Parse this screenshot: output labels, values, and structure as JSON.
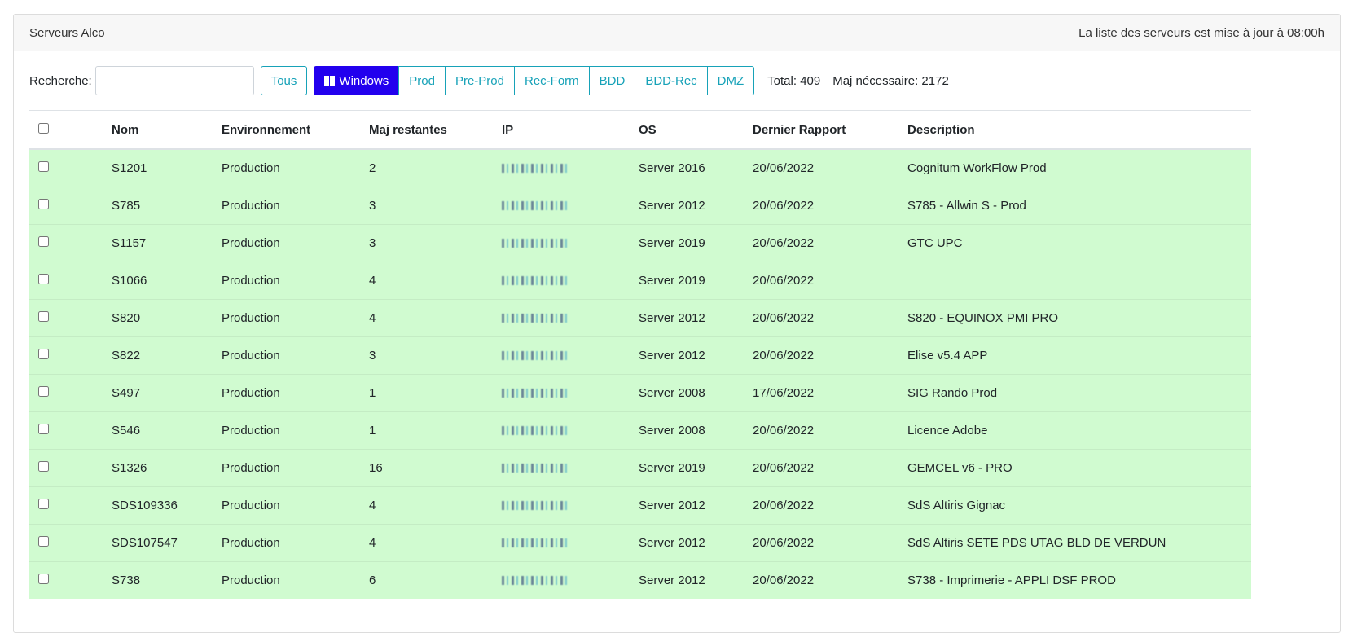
{
  "header": {
    "title": "Serveurs Alco",
    "update_notice": "La liste des serveurs est mise à jour à 08:00h"
  },
  "toolbar": {
    "search_label": "Recherche:",
    "search_value": "",
    "all_label": "Tous",
    "filters": [
      {
        "label": "Windows",
        "active": true
      },
      {
        "label": "Prod",
        "active": false
      },
      {
        "label": "Pre-Prod",
        "active": false
      },
      {
        "label": "Rec-Form",
        "active": false
      },
      {
        "label": "BDD",
        "active": false
      },
      {
        "label": "BDD-Rec",
        "active": false
      },
      {
        "label": "DMZ",
        "active": false
      }
    ],
    "total": "Total: 409",
    "maj_needed": "Maj nécessaire: 2172"
  },
  "table": {
    "columns": [
      "Nom",
      "Environnement",
      "Maj restantes",
      "IP",
      "OS",
      "Dernier Rapport",
      "Description"
    ],
    "rows": [
      {
        "nom": "S1201",
        "env": "Production",
        "maj": "2",
        "os": "Server 2016",
        "date": "20/06/2022",
        "desc": "Cognitum WorkFlow Prod"
      },
      {
        "nom": "S785",
        "env": "Production",
        "maj": "3",
        "os": "Server 2012",
        "date": "20/06/2022",
        "desc": "S785 - Allwin S - Prod"
      },
      {
        "nom": "S1157",
        "env": "Production",
        "maj": "3",
        "os": "Server 2019",
        "date": "20/06/2022",
        "desc": "GTC UPC"
      },
      {
        "nom": "S1066",
        "env": "Production",
        "maj": "4",
        "os": "Server 2019",
        "date": "20/06/2022",
        "desc": ""
      },
      {
        "nom": "S820",
        "env": "Production",
        "maj": "4",
        "os": "Server 2012",
        "date": "20/06/2022",
        "desc": "S820 - EQUINOX PMI PRO"
      },
      {
        "nom": "S822",
        "env": "Production",
        "maj": "3",
        "os": "Server 2012",
        "date": "20/06/2022",
        "desc": "Elise v5.4 APP"
      },
      {
        "nom": "S497",
        "env": "Production",
        "maj": "1",
        "os": "Server 2008",
        "date": "17/06/2022",
        "desc": "SIG Rando Prod"
      },
      {
        "nom": "S546",
        "env": "Production",
        "maj": "1",
        "os": "Server 2008",
        "date": "20/06/2022",
        "desc": "Licence Adobe"
      },
      {
        "nom": "S1326",
        "env": "Production",
        "maj": "16",
        "os": "Server 2019",
        "date": "20/06/2022",
        "desc": "GEMCEL v6 - PRO"
      },
      {
        "nom": "SDS109336",
        "env": "Production",
        "maj": "4",
        "os": "Server 2012",
        "date": "20/06/2022",
        "desc": "SdS Altiris Gignac"
      },
      {
        "nom": "SDS107547",
        "env": "Production",
        "maj": "4",
        "os": "Server 2012",
        "date": "20/06/2022",
        "desc": "SdS Altiris SETE PDS UTAG BLD DE VERDUN"
      },
      {
        "nom": "S738",
        "env": "Production",
        "maj": "6",
        "os": "Server 2012",
        "date": "20/06/2022",
        "desc": "S738 - Imprimerie - APPLI DSF PROD"
      }
    ]
  },
  "colors": {
    "accent": "#17a2b8",
    "active_filter": "#2200ee",
    "row_ok": "#d0fbd0"
  }
}
